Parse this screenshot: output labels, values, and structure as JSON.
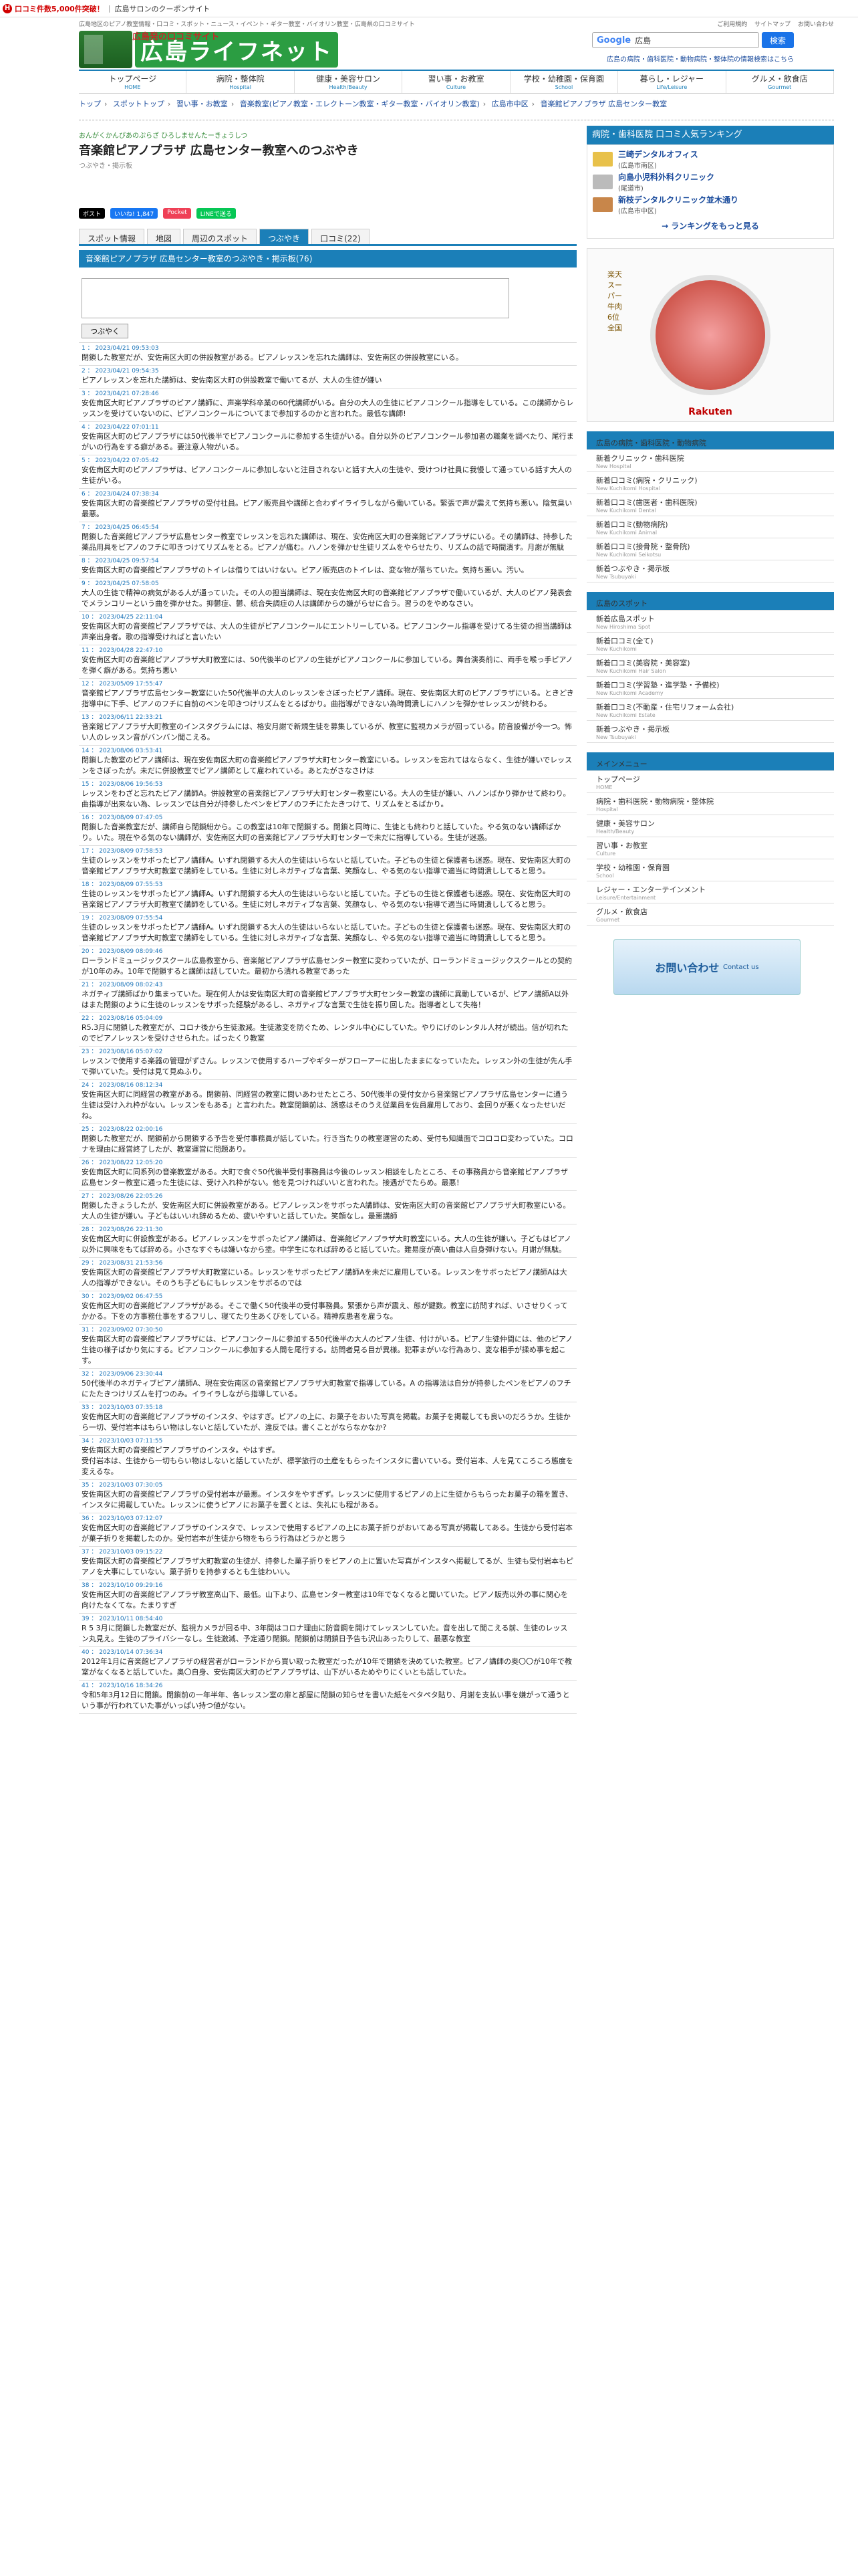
{
  "topbar": {
    "badge": "H",
    "promo": "口コミ件数5,000件突破！",
    "sep": "|",
    "brand": "広島サロンのクーポンサイト"
  },
  "smalltop": {
    "left": "広島地区のピアノ教室情報・口コミ・スポット・ニュース・イベント・ギター教室・バイオリン教室・広島県の口コミサイト",
    "links": [
      "ご利用規約",
      "サイトマップ",
      "お問い合わせ"
    ]
  },
  "header": {
    "logo": "広島ライフネット",
    "tagline": "広島発の口コミサイト",
    "search_brand": "Google",
    "search_value": "広島",
    "search_button": "検索",
    "links": "広島の病院・歯科医院・動物病院・整体院の情報検索はこちら"
  },
  "gnav": [
    {
      "label": "トップページ",
      "en": "HOME"
    },
    {
      "label": "病院・整体院",
      "en": "Hospital"
    },
    {
      "label": "健康・美容サロン",
      "en": "Health/Beauty"
    },
    {
      "label": "習い事・お教室",
      "en": "Culture"
    },
    {
      "label": "学校・幼稚園・保育園",
      "en": "School"
    },
    {
      "label": "暮らし・レジャー",
      "en": "Life/Leisure"
    },
    {
      "label": "グルメ・飲食店",
      "en": "Gourmet"
    }
  ],
  "breadcrumb": [
    "トップ",
    "スポットトップ",
    "習い事・お教室",
    "音楽教室(ピアノ教室・エレクトーン教室・ギター教室・バイオリン教室)",
    "広島市中区",
    "音楽館ピアノプラザ 広島センター教室"
  ],
  "page": {
    "kana": "おんがくかんぴあのぷらざ ひろしませんたーきょうしつ",
    "title": "音楽館ピアノプラザ 広島センター教室へのつぶやき",
    "sub": "つぶやき・掲示板"
  },
  "social": [
    {
      "label": "ポスト",
      "color": "#000"
    },
    {
      "label": "いいね! 1,847",
      "color": "#1877f2"
    },
    {
      "label": "Pocket",
      "color": "#ef4056"
    },
    {
      "label": "LINEで送る",
      "color": "#06c755"
    }
  ],
  "tabs": [
    {
      "label": "スポット情報"
    },
    {
      "label": "地図"
    },
    {
      "label": "周辺のスポット"
    },
    {
      "label": "つぶやき",
      "active": true
    },
    {
      "label": "口コミ(22)"
    }
  ],
  "board": {
    "heading": "音楽館ピアノプラザ 広島センター教室のつぶやき・掲示板(76)",
    "post_button": "つぶやく"
  },
  "posts": [
    {
      "no": "1",
      "date": "2023/04/21 09:53:03",
      "text": "閉鎖した教室だが、安佐南区大町の併設教室がある。ピアノレッスンを忘れた講師は、安佐南区の併設教室にいる。"
    },
    {
      "no": "2",
      "date": "2023/04/21 09:54:35",
      "text": "ピアノレッスンを忘れた講師は、安佐南区大町の併設教室で働いてるが、大人の生徒が嫌い"
    },
    {
      "no": "3",
      "date": "2023/04/21 07:28:46",
      "text": "安佐南区大町ピアノプラザのピアノ講師に、声楽学科卒業の60代講師がいる。自分の大人の生徒にピアノコンクール指導をしている。この講師からレッスンを受けていないのに、ピアノコンクールについてまで参加するのかと言われた。最低な講師!"
    },
    {
      "no": "4",
      "date": "2023/04/22 07:01:11",
      "text": "安佐南区大町のピアノプラザには50代後半でピアノコンクールに参加する生徒がいる。自分以外のピアノコンクール参加者の職業を調べたり、尾行まがいの行為をする癖がある。要注意人物がいる。"
    },
    {
      "no": "5",
      "date": "2023/04/22 07:05:42",
      "text": "安佐南区大町のピアノプラザは、ピアノコンクールに参加しないと注目されないと話す大人の生徒や、受けつけ社員に我慢して通っている話す大人の生徒がいる。"
    },
    {
      "no": "6",
      "date": "2023/04/24 07:38:34",
      "text": "安佐南区大町の音楽館ピアノプラザの受付社員。ピアノ販売員や講師と合わずイライラしながら働いている。緊張で声が震えて気持ち悪い。陰気臭い最悪。"
    },
    {
      "no": "7",
      "date": "2023/04/25 06:45:54",
      "text": "閉鎖した音楽館ピアノプラザ広島センター教室でレッスンを忘れた講師は、現在、安佐南区大町の音楽館ピアノプラザにいる。その講師は、持参した薬品用具をピアノのフチに叩きつけてリズムをとる。ピアノが痛む。ハノンを弾かせ生徒リズムをやらせたり、リズムの話で時間潰す。月謝が無駄"
    },
    {
      "no": "8",
      "date": "2023/04/25 09:57:54",
      "text": "安佐南区大町の音楽館ピアノプラザのトイレは借りてはいけない。ピアノ販売店のトイレは、変な物が落ちていた。気持ち悪い。汚い。"
    },
    {
      "no": "9",
      "date": "2023/04/25 07:58:05",
      "text": "大人の生徒で精神の病気がある人が通っていた。その人の担当講師は、現在安佐南区大町の音楽館ピアノプラザで働いているが、大人のピアノ発表会でメランコリーという曲を弾かせた。抑鬱症、鬱、統合失調症の人は講師からの嫌がらせに合う。習うのをやめなさい。"
    },
    {
      "no": "10",
      "date": "2023/04/25 22:11:04",
      "text": "安佐南区大町の音楽館ピアノプラザでは、大人の生徒がピアノコンクールにエントリーしている。ピアノコンクール指導を受けてる生徒の担当講師は声楽出身者。歌の指導受ければと言いたい"
    },
    {
      "no": "11",
      "date": "2023/04/28 22:47:10",
      "text": "安佐南区大町の音楽館ピアノプラザ大町教室には、50代後半のピアノの生徒がピアノコンクールに参加している。舞台演奏前に、両手を喉っ手ピアノを弾く癖がある。気持ち悪い"
    },
    {
      "no": "12",
      "date": "2023/05/09 17:55:47",
      "text": "音楽館ピアノプラザ広島センター教室にいた50代後半の大人のレッスンをさぼったピアノ講師。現在、安佐南区大町のピアノプラザにいる。ときどき指導中に下手、ピアノのフチに自前のベンを叩きつけリズムをとるばかり。曲指導ができない為時間潰しにハノンを弾かせレッスンが終わる。"
    },
    {
      "no": "13",
      "date": "2023/06/11 22:33:21",
      "text": "音楽館ピアノプラザ大町教室のインスタグラムには、格安月謝で新規生徒を募集しているが、教室に監視カメラが回っている。防音設備が今一つ。怖い人のレッスン音がバンバン聞こえる。"
    },
    {
      "no": "14",
      "date": "2023/08/06 03:53:41",
      "text": "閉鎖した教室のピアノ講師は、現在安佐南区大町の音楽館ピアノプラザ大町センター教室にいる。レッスンを忘れてはならなく、生徒が嫌いでレッスンをさぼったが。未だに併設教室でピアノ講師として雇われている。あとたがさなさけは"
    },
    {
      "no": "15",
      "date": "2023/08/06 19:56:53",
      "text": "レッスンをわざと忘れたピアノ講師A。併設教室の音楽館ピアノプラザ大町センター教室にいる。大人の生徒が嫌い、ハノンばかり弾かせて終わり。曲指導が出来ない為、レッスンでは自分が持参したペンをピアノのフチにたたきつけて、リズムをとるばかり。"
    },
    {
      "no": "16",
      "date": "2023/08/09 07:47:05",
      "text": "閉鎖した音楽教室だが、講師自ら閉鎖紛から。この教室は10年で閉鎖する。閉鎖と同時に、生徒とも終わりと話していた。やる気のない講師ばかり。いた。現在やる気のない講師が、安佐南区大町の音楽館ピアノプラザ大町センターで未だに指導している。生徒が迷惑。"
    },
    {
      "no": "17",
      "date": "2023/08/09 07:58:53",
      "text": "生徒のレッスンをサボったピアノ講師A。いずれ閉鎖する大人の生徒はいらないと話していた。子どもの生徒と保護者も迷惑。現在、安佐南区大町の音楽館ピアノプラザ大町教室で講師をしている。生徒に対しネガティブな言葉、笑顔なし、やる気のない指導で適当に時間潰ししてると思う。"
    },
    {
      "no": "18",
      "date": "2023/08/09 07:55:53",
      "text": "生徒のレッスンをサボったピアノ講師A。いずれ閉鎖する大人の生徒はいらないと話していた。子どもの生徒と保護者も迷惑。現在、安佐南区大町の音楽館ピアノプラザ大町教室で講師をしている。生徒に対しネガティブな言葉、笑顔なし、やる気のない指導で適当に時間潰ししてると思う。"
    },
    {
      "no": "19",
      "date": "2023/08/09 07:55:54",
      "text": "生徒のレッスンをサボったピアノ講師A。いずれ閉鎖する大人の生徒はいらないと話していた。子どもの生徒と保護者も迷惑。現在、安佐南区大町の音楽館ピアノプラザ大町教室で講師をしている。生徒に対しネガティブな言葉、笑顔なし、やる気のない指導で適当に時間潰ししてると思う。"
    },
    {
      "no": "20",
      "date": "2023/08/09 08:09:46",
      "text": "ローランドミュージックスクール広島教室から、音楽館ピアノプラザ広島センター教室に変わっていたが、ローランドミュージックスクールとの契約が10年のみ。10年で閉鎖すると講師は話していた。最初から潰れる教室であった"
    },
    {
      "no": "21",
      "date": "2023/08/09 08:02:43",
      "text": "ネガティブ講師ばかり集まっていた。現在何人かは安佐南区大町の音楽館ピアノプラザ大町センター教室の講師に異動しているが、ピアノ講師A以外はまた閉鎖のように生徒のレッスンをサボった経験があるし、ネガティブな言葉で生徒を振り回した。指導者として失格！"
    },
    {
      "no": "22",
      "date": "2023/08/16 05:04:09",
      "text": "R5.3月に閉鎖した教室だが、コロナ後から生徒激減。生徒激変を防ぐため、レンタル中心にしていた。やりにげのレンタル人材が続出。信が切れたのでピアノレッスンを受けさせられた。ばったくり教室"
    },
    {
      "no": "23",
      "date": "2023/08/16 05:07:02",
      "text": "レッスンで使用する楽器の管理がずさん。レッスンで使用するハープやギターがフローアーに出したままになっていたた。レッスン外の生徒が先ん手で弾いていた。受付は見て見ぬふり。"
    },
    {
      "no": "24",
      "date": "2023/08/16 08:12:34",
      "text": "安佐南区大町に同経営の教室がある。閉鎖前、同経営の教室に問いあわせたところ、50代後半の受付女から音楽館ピアノプラザ広島センターに通う生徒は受け入れ枠がない。レッスンをもある」と言われた。教室閉鎖前は、誘惑はそのうえ従業員を佐員雇用しており、金回りが悪くなったせいだね。"
    },
    {
      "no": "25",
      "date": "2023/08/22 02:00:16",
      "text": "閉鎖した教室だが、閉鎖前から閉鎖する予告を受付事務員が話していた。行き当たりの教室運営のため、受付も知識面でコロコロ変わっていた。コロナを理由に経営終了したが、教室運営に問題あり。"
    },
    {
      "no": "26",
      "date": "2023/08/22 12:05:20",
      "text": "安佐南区大町に同系列の音楽教室がある。大町で食ぐ50代後半受付事務員は今後のレッスン相談をしたところ、その事務員から音楽館ピアノプラザ広島センター教室に通った生徒には、受け入れ枠がない。他を見つければいいと言われた。接遇がでたらめ。最悪！"
    },
    {
      "no": "27",
      "date": "2023/08/26 22:05:26",
      "text": "閉鎖したきょうしたが、安佐南区大町に併設教室がある。ピアノレッスンをサボったA講師は、安佐南区大町の音楽館ピアノプラザ大町教室にいる。大人の生徒が嫌い。子どもはいいれ辞めるため、疲いやすいと話していた。笑顔なし。最悪講師"
    },
    {
      "no": "28",
      "date": "2023/08/26 22:11:30",
      "text": "安佐南区大町に併設教室がある。ピアノレッスンをサボったピアノ講師は、音楽館ピアノプラザ大町教室にいる。大人の生徒が嫌い。子どもはピアノ以外に興味をもてば辞める。小さなすぐもは嫌いなから塗。中学生になれば辞めると話していた。難易度が高い曲は人自身弾けない。月謝が無駄。"
    },
    {
      "no": "29",
      "date": "2023/08/31 21:53:56",
      "text": "安佐南区大町の音楽館ピアノプラザ大町教室にいる。レッスンをサボったピアノ講師Aを未だに雇用している。レッスンをサボったピアノ講師Aは大人の指導ができない。そのうち子どもにもレッスンをサボるのでは"
    },
    {
      "no": "30",
      "date": "2023/09/02 06:47:55",
      "text": "安佐南区大町の音楽館ピアノプラザがある。そこで働く50代後半の受付事務員。緊張から声が震え、態が鍵数。教室に訪問すれば、いさせりくってかかる。下をの方事務仕事をするフリし、寝てたり生あくびをしている。精神疾患者を雇うな。"
    },
    {
      "no": "31",
      "date": "2023/09/02 07:30:50",
      "text": "安佐南区大町の音楽館ピアノプラザには、ピアノコンクールに参加する50代後半の大人のピアノ生徒、付けがいる。ピアノ生徒仲間には、他のピアノ生徒の様子ばかり気にする。ピアノコンクールに参加する人間を尾行する。訪問者見る目が異様。犯罪まがいな行為あり、変な相手が揉め事を起こす。"
    },
    {
      "no": "32",
      "date": "2023/09/06 23:30:44",
      "text": "50代後半のネガティブピアノ講師A、現在安佐南区の音楽館ピアノプラザ大町教室で指導している。A の指導法は自分が持参したペンをピアノのフチにたたきつけリズムを打つのみ。イライラしながら指導している。"
    },
    {
      "no": "33",
      "date": "2023/10/03 07:35:18",
      "text": "安佐南区大町の音楽館ピアノプラザのインスタ、やはすぎ。ピアノの上に、お菓子をおいた写真を掲載。お菓子を掲載しても良いのだろうか。生徒から一切、受付岩本はもらい物はしないと話していたが、違反では。書くことがならなかなか?"
    },
    {
      "no": "34",
      "date": "2023/10/03 07:11:55",
      "text": "安佐南区大町の音楽館ピアノプラザのインスタ。やはすぎ。\n受付岩本は、生徒から一切もらい物はしないと話していたが、標学旅行の土産をもらったインスタに書いている。受付岩本、人を見てころころ態度を変えるな。"
    },
    {
      "no": "35",
      "date": "2023/10/03 07:30:05",
      "text": "安佐南区大町の音楽館ピアノプラザの受付岩本が最悪。インスタをやすぎず。レッスンに使用するピアノの上に生徒からもらったお菓子の箱を置き、インスタに掲載していた。レッスンに使うピアノにお菓子を置くとは、失礼にも程がある。"
    },
    {
      "no": "36",
      "date": "2023/10/03 07:12:07",
      "text": "安佐南区大町の音楽館ピアノプラザのインスタで、レッスンで使用するピアノの上にお菓子折りがおいてある写真が掲載してある。生徒から受付岩本が菓子折りを掲載したのか。受付岩本が生徒から物をもらう行為はどうかと思う"
    },
    {
      "no": "37",
      "date": "2023/10/03 09:15:22",
      "text": "安佐南区大町の音楽館ピアノプラザ大町教室の生徒が、持参した菓子折りをピアノの上に置いた写真がインスタへ掲載してるが、生徒も受付岩本もピアノを大事にしていない。菓子折りを持参するとも生徒わいい。"
    },
    {
      "no": "38",
      "date": "2023/10/10 09:29:16",
      "text": "安佐南区大町の音楽館ピアノプラザ教室高山下、最低。山下より、広島センター教室は10年でなくなると聞いていた。ピアノ販売以外の事に関心を向けたなくてな。たまりすぎ"
    },
    {
      "no": "39",
      "date": "2023/10/11 08:54:40",
      "text": "R 5 3月に閉鎖した教室だが、監視カメラが回る中、3年間はコロナ理由に防音鋼を開けてレッスンしていた。音を出して聞こえる前、生徒のレッスン丸見え。生徒のプライバシーなし。生徒激減、予定通り閉鎖。閉鎖前は閉鎖日予告も沢山あったりして、最悪な教室"
    },
    {
      "no": "40",
      "date": "2023/10/14 07:36:34",
      "text": "2012年1月に音楽館ピアノプラザの経営者がローランドから買い取った教室だったが10年で閉鎖を決めていた教室。ピアノ講師の奥〇〇が10年で教室がなくなると話していた。奥〇自身、安佐南区大町のピアノプラザは、山下がいるためやりにくいとも話していた。"
    },
    {
      "no": "41",
      "date": "2023/10/16 18:34:26",
      "text": "令和5年3月12日に閉鎖。閉鎖前の一年半年、各レッスン室の扉と部屋に閉鎖の知らせを書いた紙をべタペタ貼り、月謝を支払い事を嫌がって通うという事が行われていた事がいっぱい持つ値がない。"
    }
  ],
  "side": {
    "ranking": {
      "title": "病院・歯科医院 口コミ人気ランキング",
      "items": [
        {
          "name": "三崎デンタルオフィス",
          "area": "(広島市南区)"
        },
        {
          "name": "向島小児科外科クリニック",
          "area": "(尾道市)"
        },
        {
          "name": "新枝デンタルクリニック並木通り",
          "area": "(広島市中区)"
        }
      ],
      "more": "→ ランキングをもっと見る"
    },
    "ad": {
      "brand": "Rakuten",
      "text": "楽天スーパー牛肉 6位 全国"
    },
    "hospital": {
      "title": "広島の病院・歯科医院・動物病院",
      "items": [
        {
          "label": "新着クリニック・歯科医院",
          "en": "New Hospital"
        },
        {
          "label": "新着口コミ(病院・クリニック)",
          "en": "New Kuchikomi Hospital"
        },
        {
          "label": "新着口コミ(歯医者・歯科医院)",
          "en": "New Kuchikomi Dental"
        },
        {
          "label": "新着口コミ(動物病院)",
          "en": "New Kuchikomi Animal"
        },
        {
          "label": "新着口コミ(接骨院・整骨院)",
          "en": "New Kuchikomi Seikotsu"
        },
        {
          "label": "新着つぶやき・掲示板",
          "en": "New Tsubuyaki"
        }
      ]
    },
    "spot": {
      "title": "広島のスポット",
      "items": [
        {
          "label": "新着広島スポット",
          "en": "New Hiroshima Spot"
        },
        {
          "label": "新着口コミ(全て)",
          "en": "New Kuchikomi"
        },
        {
          "label": "新着口コミ(美容院・美容室)",
          "en": "New Kuchikomi Hair Salon"
        },
        {
          "label": "新着口コミ(学習塾・進学塾・予備校)",
          "en": "New Kuchikomi Academy"
        },
        {
          "label": "新着口コミ(不動産・住宅リフォーム会社)",
          "en": "New Kuchikomi Estate"
        },
        {
          "label": "新着つぶやき・掲示板",
          "en": "New Tsubuyaki"
        }
      ]
    },
    "menu": {
      "title": "メインメニュー",
      "items": [
        {
          "label": "トップページ",
          "en": "HOME"
        },
        {
          "label": "病院・歯科医院・動物病院・整体院",
          "en": "Hospital"
        },
        {
          "label": "健康・美容サロン",
          "en": "Health/Beauty"
        },
        {
          "label": "習い事・お教室",
          "en": "Culture"
        },
        {
          "label": "学校・幼稚園・保育園",
          "en": "School"
        },
        {
          "label": "レジャー・エンターテインメント",
          "en": "Leisure/Entertainment"
        },
        {
          "label": "グルメ・飲食店",
          "en": "Gourmet"
        }
      ]
    },
    "contact": {
      "label": "お問い合わせ",
      "sub": "Contact us"
    }
  }
}
